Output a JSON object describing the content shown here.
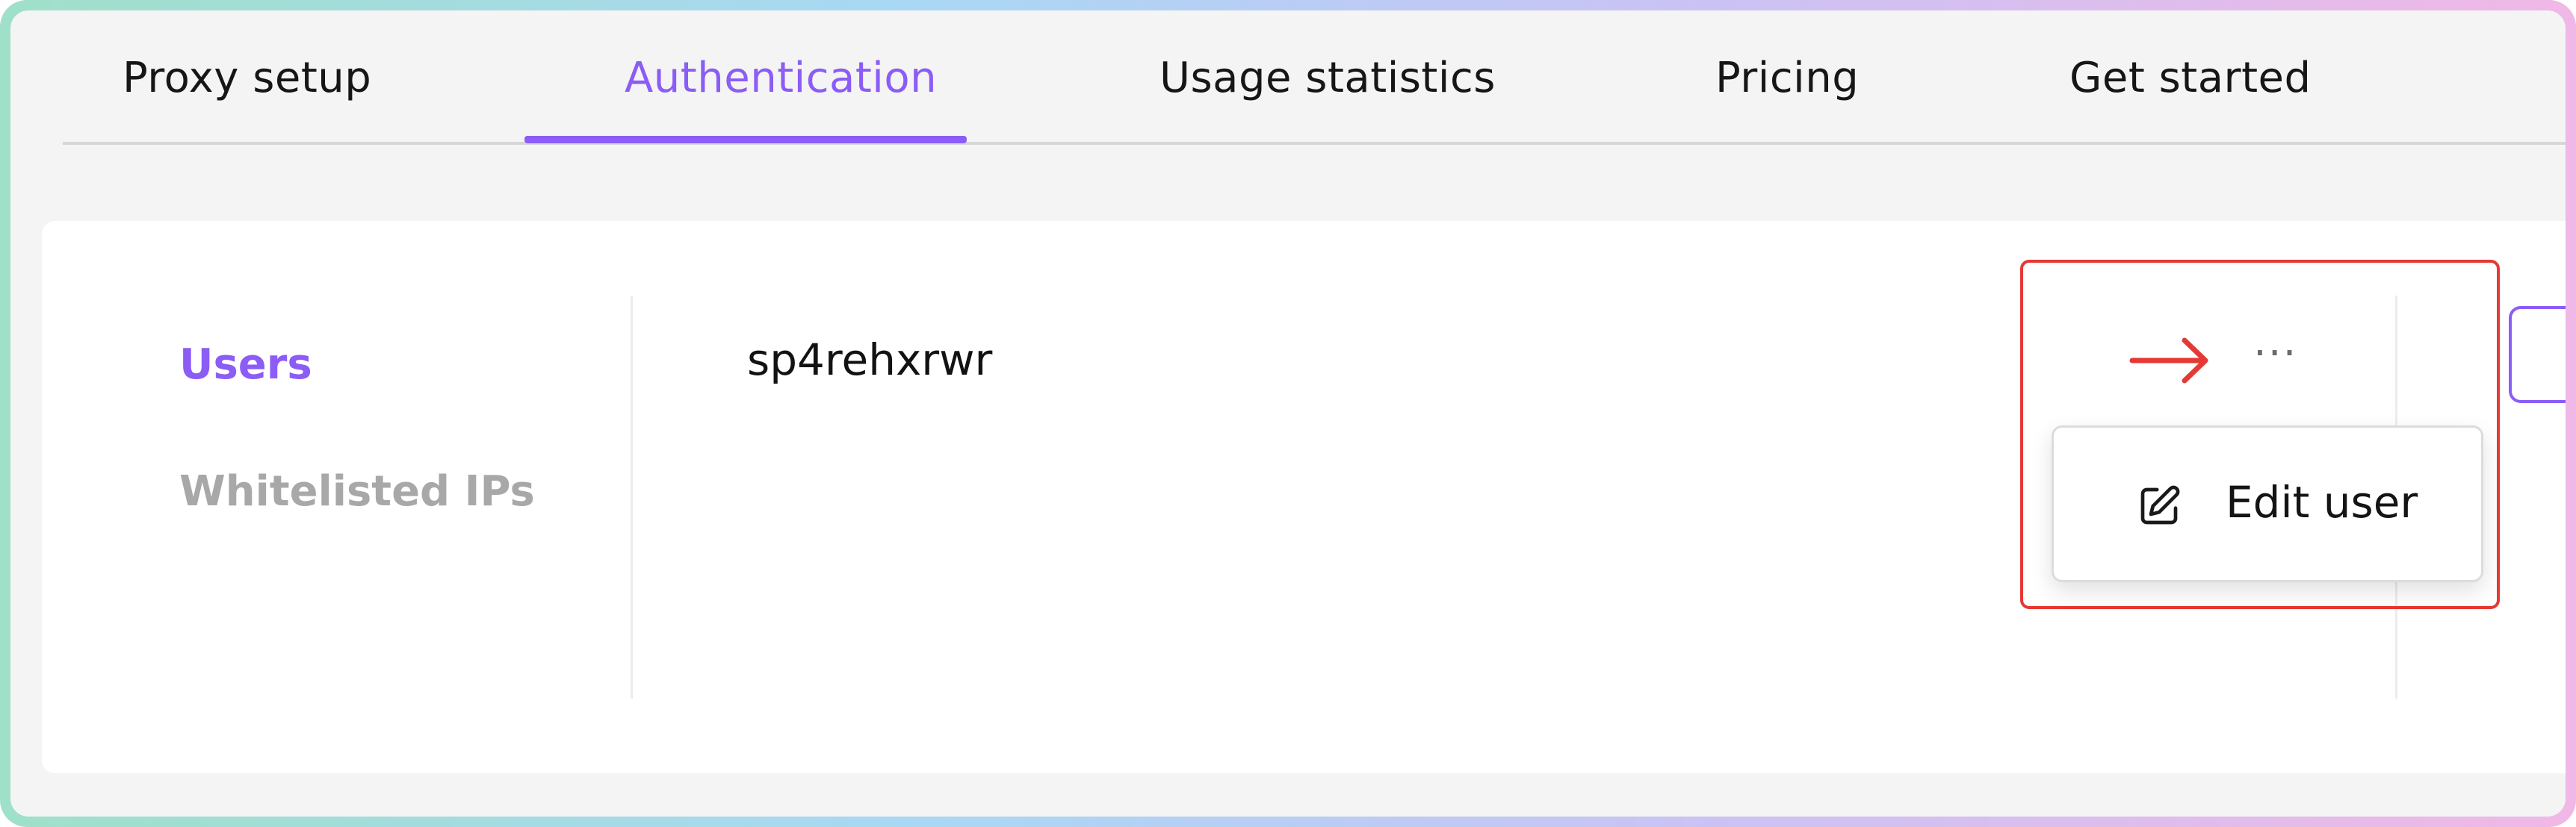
{
  "tabs": [
    {
      "label": "Proxy setup",
      "active": false
    },
    {
      "label": "Authentication",
      "active": true
    },
    {
      "label": "Usage statistics",
      "active": false
    },
    {
      "label": "Pricing",
      "active": false
    },
    {
      "label": "Get started",
      "active": false
    }
  ],
  "sidebar": {
    "items": [
      {
        "label": "Users",
        "active": true
      },
      {
        "label": "Whitelisted IPs",
        "active": false
      }
    ]
  },
  "users": {
    "rows": [
      {
        "username": "sp4rehxrwr",
        "actions_label": "···"
      }
    ]
  },
  "dropdown": {
    "items": [
      {
        "label": "Edit user",
        "icon": "edit-icon"
      }
    ]
  },
  "colors": {
    "accent": "#8b5cf6",
    "highlight": "#e53935",
    "muted_text": "#a8a8a8"
  }
}
